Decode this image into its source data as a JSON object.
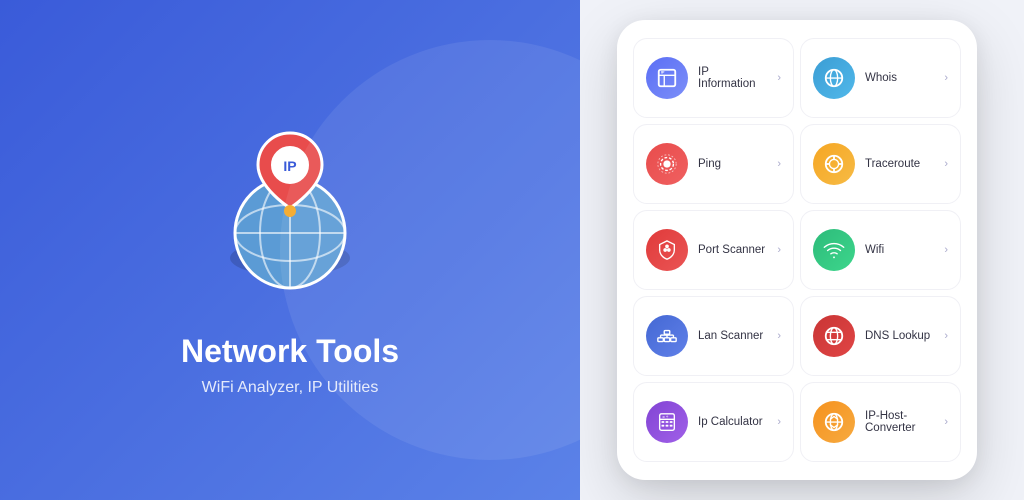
{
  "left": {
    "title": "Network Tools",
    "subtitle": "WiFi Analyzer, IP Utilities"
  },
  "right": {
    "tools": [
      {
        "id": "ip-information",
        "label": "IP Information",
        "color": "color-blue",
        "icon": "🗺",
        "unicode": "📋"
      },
      {
        "id": "whois",
        "label": "Whois",
        "color": "color-teal",
        "icon": "🌐",
        "unicode": "🌐"
      },
      {
        "id": "ping",
        "label": "Ping",
        "color": "color-red",
        "icon": "🔍",
        "unicode": "🔍"
      },
      {
        "id": "traceroute",
        "label": "Traceroute",
        "color": "color-orange",
        "icon": "⊕",
        "unicode": "⊕"
      },
      {
        "id": "port-scanner",
        "label": "Port Scanner",
        "color": "color-crimson",
        "icon": "⚡",
        "unicode": "⚡"
      },
      {
        "id": "wifi",
        "label": "Wifi",
        "color": "color-green",
        "icon": "📊",
        "unicode": "📊"
      },
      {
        "id": "lan-scanner",
        "label": "Lan Scanner",
        "color": "color-navy",
        "icon": "🖧",
        "unicode": "🖧"
      },
      {
        "id": "dns-lookup",
        "label": "DNS Lookup",
        "color": "color-darkred",
        "icon": "⊙",
        "unicode": "⊙"
      },
      {
        "id": "ip-calculator",
        "label": "Ip Calculator",
        "color": "color-purple",
        "icon": "🖩",
        "unicode": "🖩"
      },
      {
        "id": "ip-host-converter",
        "label": "IP-Host-Converter",
        "color": "color-amber",
        "icon": "⇄",
        "unicode": "⇄"
      }
    ]
  }
}
